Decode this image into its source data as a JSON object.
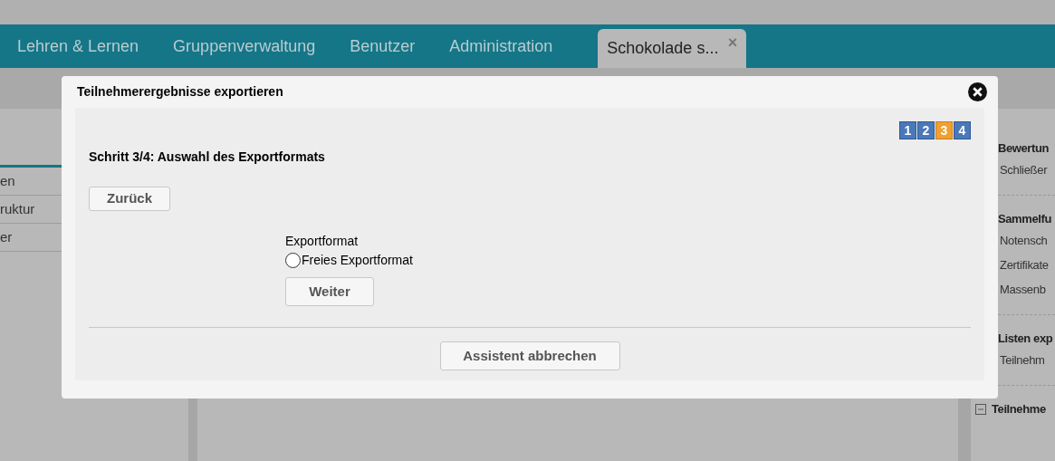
{
  "nav": {
    "tabs": [
      {
        "label": "Lehren & Lernen",
        "selected": false
      },
      {
        "label": "Gruppenverwaltung",
        "selected": false
      },
      {
        "label": "Benutzer",
        "selected": false
      },
      {
        "label": "Administration",
        "selected": false
      },
      {
        "label": "Schokolade s...",
        "selected": true,
        "close": "×"
      }
    ]
  },
  "sidebar": {
    "items": [
      "en",
      "ruktur",
      "er"
    ]
  },
  "right_panel": {
    "sections": [
      {
        "title": "Bewertun",
        "kind": "plain",
        "items": [
          "Schließer"
        ]
      },
      {
        "title": "Sammelfu",
        "kind": "plain",
        "items": [
          "Notensch",
          "Zertifikate",
          "Massenb"
        ]
      },
      {
        "title": "Listen exp",
        "kind": "plain",
        "items": [
          "Teilnehm"
        ]
      },
      {
        "title": "Teilnehme",
        "kind": "collapsible"
      }
    ]
  },
  "dialog": {
    "title": "Teilnehmerergebnisse exportieren",
    "steps": [
      {
        "label": "1",
        "selected": false
      },
      {
        "label": "2",
        "selected": false
      },
      {
        "label": "3",
        "selected": true
      },
      {
        "label": "4",
        "selected": false
      }
    ],
    "heading": "Schritt 3/4: Auswahl des Exportformats",
    "back_button": "Zurück",
    "field_label": "Exportformat",
    "options": [
      {
        "label": "Freies Exportformat",
        "selected": false
      }
    ],
    "next_button": "Weiter",
    "cancel_button": "Assistent abbrechen"
  }
}
